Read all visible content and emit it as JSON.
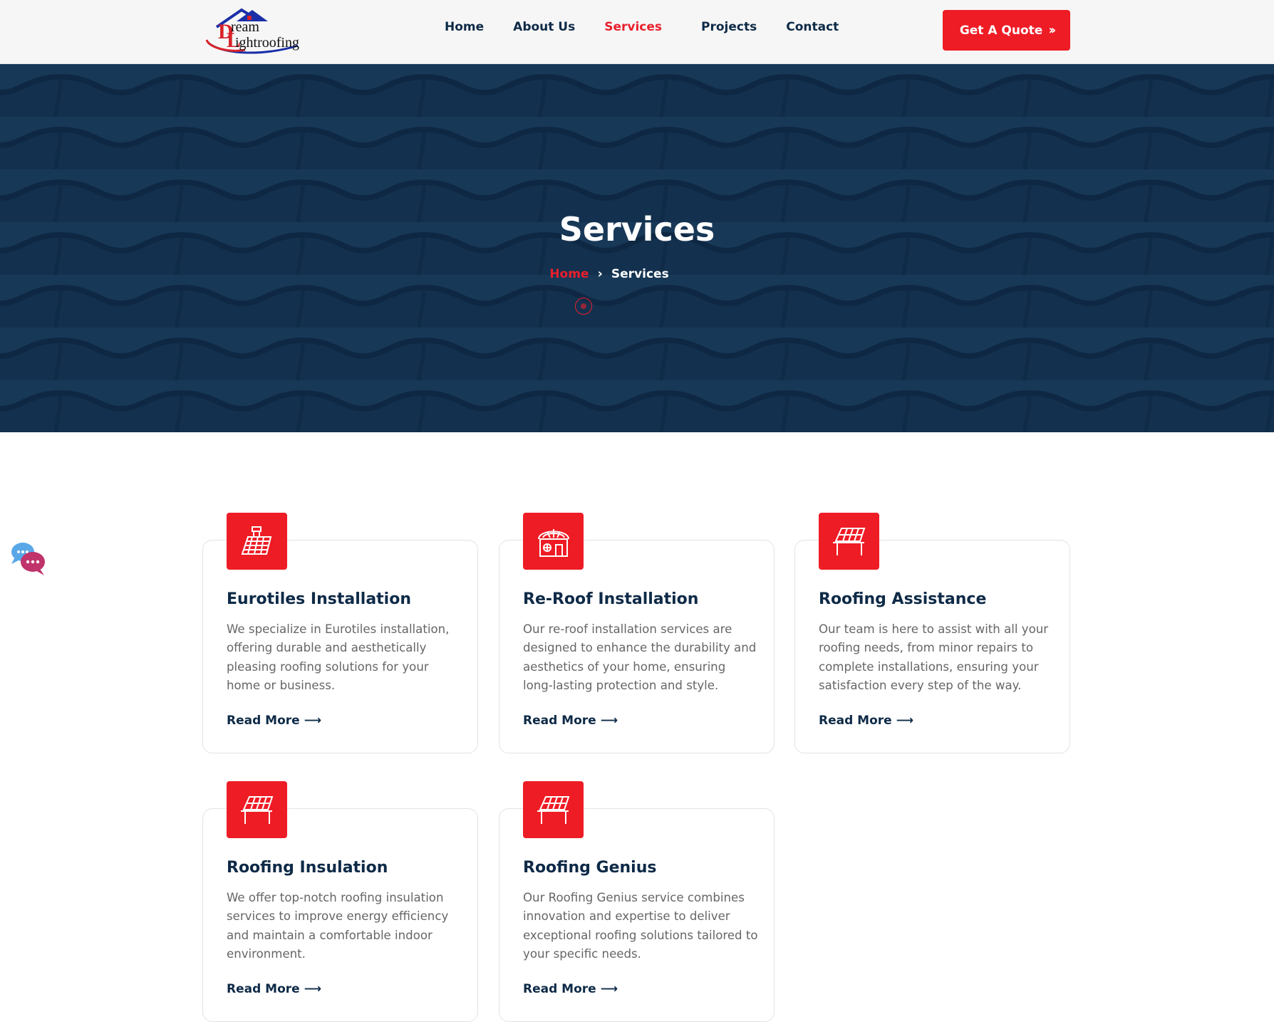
{
  "header": {
    "logo": {
      "text_prefix": "ream",
      "text_suffix": "ightroofing",
      "alt_letter": "D",
      "alt_letter_2": "L"
    },
    "nav": [
      {
        "label": "Home",
        "active": false
      },
      {
        "label": "About Us",
        "active": false
      },
      {
        "label": "Services",
        "active": true
      },
      {
        "label": "Projects",
        "active": false
      },
      {
        "label": "Contact",
        "active": false
      }
    ],
    "quote_button": "Get A Quote"
  },
  "hero": {
    "title": "Services",
    "breadcrumb": {
      "home": "Home",
      "current": "Services"
    }
  },
  "services": [
    {
      "title": "Eurotiles Installation",
      "icon": "roof-tiles-icon",
      "description": "We specialize in Eurotiles installation, offering durable and aesthetically pleasing roofing solutions for your home or business.",
      "link": "Read More"
    },
    {
      "title": "Re-Roof Installation",
      "icon": "house-roof-icon",
      "description": "Our re-roof installation services are designed to enhance the durability and aesthetics of your home, ensuring long-lasting protection and style.",
      "link": "Read More"
    },
    {
      "title": "Roofing Assistance",
      "icon": "roof-panel-icon",
      "description": "Our team is here to assist with all your roofing needs, from minor repairs to complete installations, ensuring your satisfaction every step of the way.",
      "link": "Read More"
    },
    {
      "title": "Roofing Insulation",
      "icon": "roof-panel-icon",
      "description": "We offer top-notch roofing insulation services to improve energy efficiency and maintain a comfortable indoor environment.",
      "link": "Read More"
    },
    {
      "title": "Roofing Genius",
      "icon": "roof-panel-icon",
      "description": "Our Roofing Genius service combines innovation and expertise to deliver exceptional roofing solutions tailored to your specific needs.",
      "link": "Read More"
    }
  ],
  "colors": {
    "accent": "#ee1c25",
    "navy": "#0e2a47",
    "text_muted": "#666666"
  }
}
